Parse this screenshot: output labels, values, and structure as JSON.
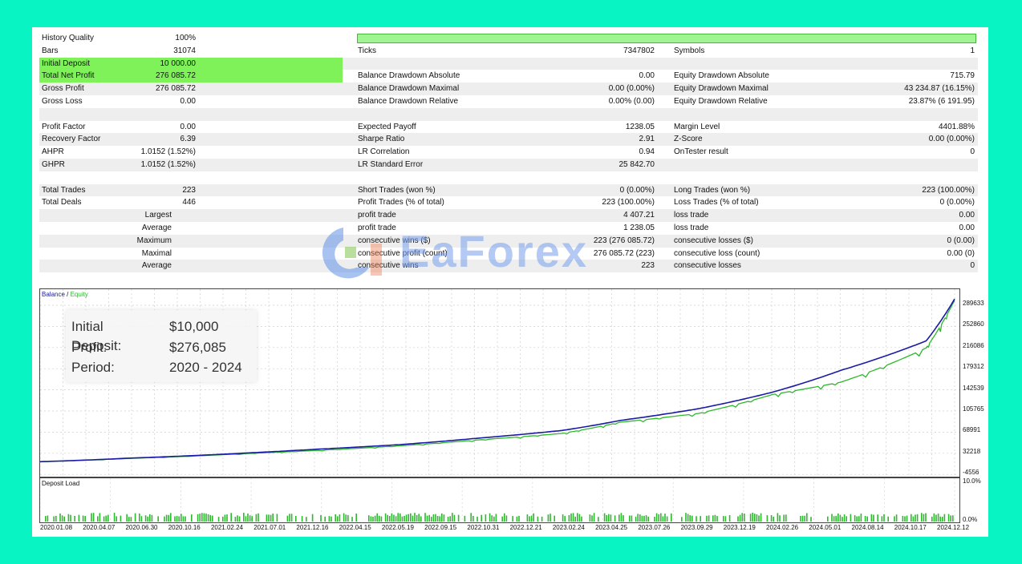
{
  "stats": {
    "history_quality": {
      "label": "History Quality",
      "value": "100%"
    },
    "quality_bar_fraction": 1.0,
    "rows": [
      {
        "c1": [
          "Bars",
          "31074"
        ],
        "c2": [
          "Ticks",
          "7347802"
        ],
        "c3": [
          "Symbols",
          "1"
        ]
      },
      {
        "c1": [
          "Initial Deposit",
          "10 000.00"
        ],
        "c2": [
          "",
          ""
        ],
        "c3": [
          "",
          ""
        ]
      },
      {
        "c1": [
          "Total Net Profit",
          "276 085.72"
        ],
        "c2": [
          "Balance Drawdown Absolute",
          "0.00"
        ],
        "c3": [
          "Equity Drawdown Absolute",
          "715.79"
        ]
      },
      {
        "c1": [
          "Gross Profit",
          "276 085.72"
        ],
        "c2": [
          "Balance Drawdown Maximal",
          "0.00 (0.00%)"
        ],
        "c3": [
          "Equity Drawdown Maximal",
          "43 234.87 (16.15%)"
        ]
      },
      {
        "c1": [
          "Gross Loss",
          "0.00"
        ],
        "c2": [
          "Balance Drawdown Relative",
          "0.00% (0.00)"
        ],
        "c3": [
          "Equity Drawdown Relative",
          "23.87% (6 191.95)"
        ]
      },
      {
        "c1": [
          "",
          ""
        ],
        "c2": [
          "",
          ""
        ],
        "c3": [
          "",
          ""
        ]
      },
      {
        "c1": [
          "Profit Factor",
          "0.00"
        ],
        "c2": [
          "Expected Payoff",
          "1238.05"
        ],
        "c3": [
          "Margin Level",
          "4401.88%"
        ]
      },
      {
        "c1": [
          "Recovery Factor",
          "6.39"
        ],
        "c2": [
          "Sharpe Ratio",
          "2.91"
        ],
        "c3": [
          "Z-Score",
          "0.00 (0.00%)"
        ]
      },
      {
        "c1": [
          "AHPR",
          "1.0152 (1.52%)"
        ],
        "c2": [
          "LR Correlation",
          "0.94"
        ],
        "c3": [
          "OnTester result",
          "0"
        ]
      },
      {
        "c1": [
          "GHPR",
          "1.0152 (1.52%)"
        ],
        "c2": [
          "LR Standard Error",
          "25 842.70"
        ],
        "c3": [
          "",
          ""
        ]
      },
      {
        "c1": [
          "",
          ""
        ],
        "c2": [
          "",
          ""
        ],
        "c3": [
          "",
          ""
        ]
      },
      {
        "c1": [
          "Total Trades",
          "223"
        ],
        "c2": [
          "Short Trades (won %)",
          "0 (0.00%)"
        ],
        "c3": [
          "Long Trades (won %)",
          "223 (100.00%)"
        ]
      },
      {
        "c1": [
          "Total Deals",
          "446"
        ],
        "c2": [
          "Profit Trades (% of total)",
          "223 (100.00%)"
        ],
        "c3": [
          "Loss Trades (% of total)",
          "0 (0.00%)"
        ]
      },
      {
        "c1r": "Largest",
        "c2": [
          "profit trade",
          "4 407.21"
        ],
        "c3": [
          "loss trade",
          "0.00"
        ]
      },
      {
        "c1r": "Average",
        "c2": [
          "profit trade",
          "1 238.05"
        ],
        "c3": [
          "loss trade",
          "0.00"
        ]
      },
      {
        "c1r": "Maximum",
        "c2": [
          "consecutive wins ($)",
          "223 (276 085.72)"
        ],
        "c3": [
          "consecutive losses ($)",
          "0 (0.00)"
        ]
      },
      {
        "c1r": "Maximal",
        "c2": [
          "consecutive profit (count)",
          "276 085.72 (223)"
        ],
        "c3": [
          "consecutive loss (count)",
          "0.00 (0)"
        ]
      },
      {
        "c1r": "Average",
        "c2": [
          "consecutive wins",
          "223"
        ],
        "c3": [
          "consecutive losses",
          "0"
        ]
      }
    ]
  },
  "chart": {
    "legend_balance": "Balance",
    "legend_sep": " / ",
    "legend_equity": "Equity",
    "info": [
      {
        "key": "Initial Deposit:",
        "value": "$10,000"
      },
      {
        "key": "Profit:",
        "value": "$276,085"
      },
      {
        "key": "Period:",
        "value": "2020 - 2024"
      }
    ],
    "y_ticks": [
      "289633",
      "252860",
      "216086",
      "179312",
      "142539",
      "105765",
      "68991",
      "32218",
      "-4556"
    ],
    "load_label": "Deposit Load",
    "load_ticks": [
      "10.0%",
      "0.0%"
    ],
    "x_ticks": [
      "2020.01.08",
      "2020.04.07",
      "2020.06.30",
      "2020.10.16",
      "2021.02.24",
      "2021.07.01",
      "2021.12.16",
      "2022.04.15",
      "2022.05.19",
      "2022.09.15",
      "2022.10.31",
      "2022.12.21",
      "2023.02.24",
      "2023.04.25",
      "2023.07.26",
      "2023.09.29",
      "2023.12.19",
      "2024.02.26",
      "2024.05.01",
      "2024.08.14",
      "2024.10.17",
      "2024.12.12"
    ],
    "colors": {
      "balance": "#1a1aa6",
      "equity": "#2db82d",
      "deposit_load": "#2db82d",
      "highlight": "#7ff25a"
    }
  },
  "chart_data": {
    "type": "line",
    "title": "",
    "series": [
      {
        "name": "Balance",
        "x": [
          "2020.01.08",
          "2020.06.30",
          "2021.02.24",
          "2021.07.01",
          "2021.12.16",
          "2022.05.19",
          "2022.10.31",
          "2023.02.24",
          "2023.07.26",
          "2023.12.19",
          "2024.05.01",
          "2024.10.17",
          "2024.12.12"
        ],
        "values": [
          10000,
          16000,
          25000,
          31000,
          39000,
          50000,
          63000,
          80000,
          100000,
          128000,
          165000,
          215000,
          286085
        ]
      },
      {
        "name": "Equity",
        "x": [
          "2020.01.08",
          "2020.06.30",
          "2021.02.24",
          "2021.07.01",
          "2021.12.16",
          "2022.05.19",
          "2022.10.31",
          "2023.02.24",
          "2023.07.26",
          "2023.12.19",
          "2024.05.01",
          "2024.10.17",
          "2024.12.12"
        ],
        "values": [
          10000,
          15500,
          24000,
          29000,
          37000,
          47000,
          58000,
          77000,
          92000,
          124000,
          145000,
          203000,
          284000
        ]
      }
    ],
    "ylim": [
      -4556,
      300000
    ],
    "grid": true
  },
  "watermark": {
    "text": "EaForex"
  }
}
